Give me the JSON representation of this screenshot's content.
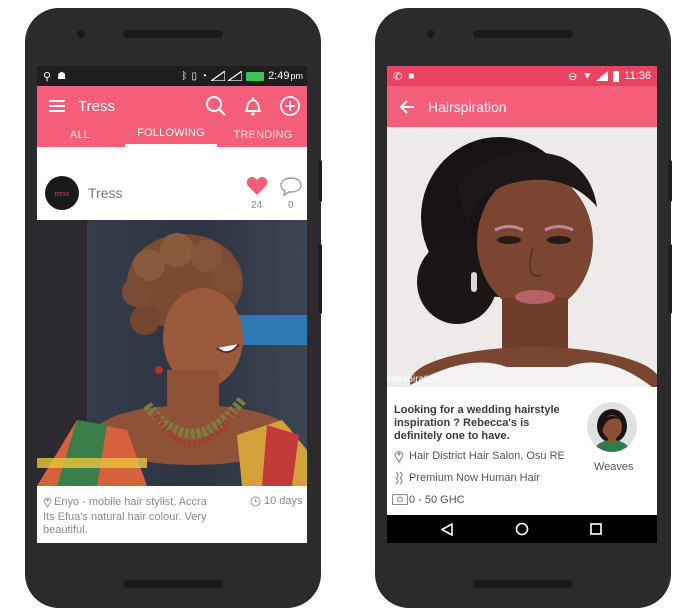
{
  "left": {
    "status": {
      "time": "2:49",
      "ampm": "pm"
    },
    "app_title": "Tress",
    "tabs": [
      {
        "label": "ALL",
        "active": false
      },
      {
        "label": "FOLLOWING",
        "active": true
      },
      {
        "label": "TRENDING",
        "active": false
      }
    ],
    "post": {
      "avatar_text": "tress",
      "author": "Tress",
      "likes": "24",
      "comments": "0",
      "location": "Enyo - mobile hair stylist, Accra",
      "time_ago": "10 days",
      "caption": "Its Efua's natural hair colour. Very beautiful."
    }
  },
  "right": {
    "status": {
      "time": "11:36"
    },
    "title": "Hairspiration",
    "image_caption": "Hairspiration",
    "description": "Looking for a wedding hairstyle inspiration ? Rebecca's is definitely one to have.",
    "salon": "Hair District Hair Salon, Osu RE",
    "hair": "Premium Now Human Hair",
    "price": "0 - 50 GHC",
    "category": "Weaves"
  },
  "colors": {
    "accent": "#f45e78",
    "frame": "#2b2b2d"
  }
}
